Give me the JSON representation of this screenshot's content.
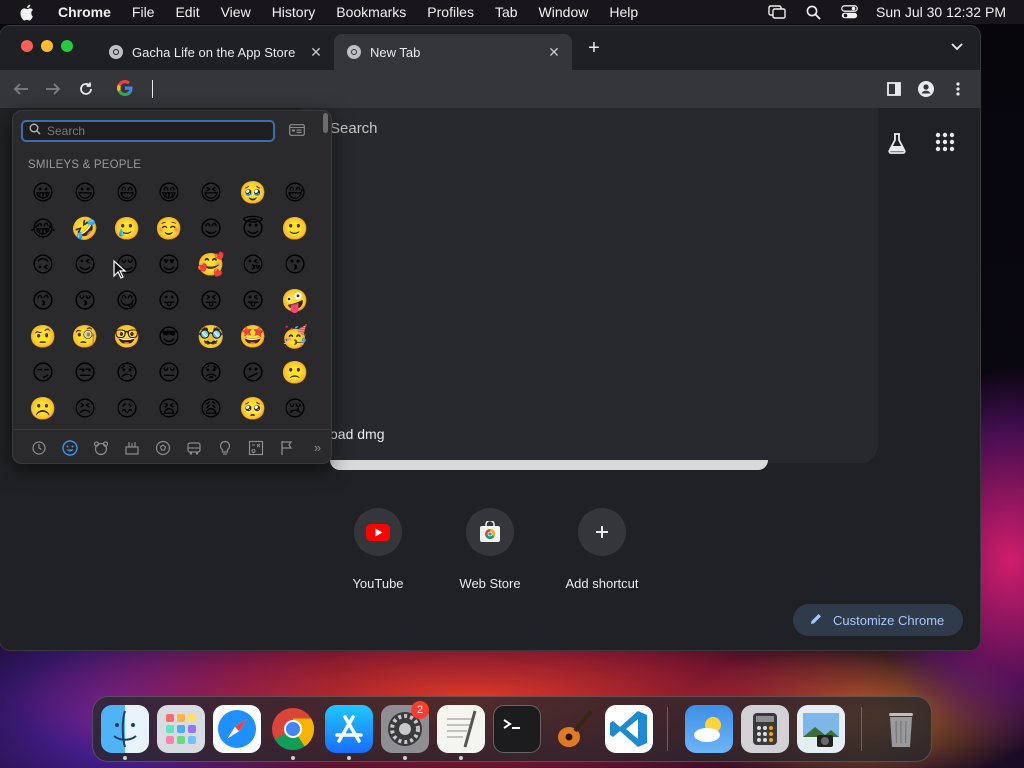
{
  "menubar": {
    "app_name": "Chrome",
    "items": [
      "File",
      "Edit",
      "View",
      "History",
      "Bookmarks",
      "Profiles",
      "Tab",
      "Window",
      "Help"
    ],
    "clock": "Sun Jul 30  12:32 PM"
  },
  "browser": {
    "tabs": [
      {
        "title": "Gacha Life on the App Store",
        "active": false
      },
      {
        "title": "New Tab",
        "active": true
      }
    ],
    "omnibox_value": ""
  },
  "newtab": {
    "search_hint": "Search",
    "suggestion": "oad dmg",
    "shortcuts": [
      {
        "label": "YouTube",
        "icon": "youtube-icon"
      },
      {
        "label": "Web Store",
        "icon": "web-store-icon"
      },
      {
        "label": "Add shortcut",
        "icon": "plus-icon"
      }
    ],
    "customize_label": "Customize Chrome"
  },
  "emoji_picker": {
    "search_placeholder": "Search",
    "section_title": "SMILEYS & PEOPLE",
    "emojis": [
      "😀",
      "😃",
      "😄",
      "😁",
      "😆",
      "🥹",
      "😅",
      "😂",
      "🤣",
      "🥲",
      "☺️",
      "😊",
      "😇",
      "🙂",
      "🙃",
      "😉",
      "😌",
      "😍",
      "🥰",
      "😘",
      "😗",
      "😙",
      "😚",
      "😋",
      "😛",
      "😝",
      "😜",
      "🤪",
      "🤨",
      "🧐",
      "🤓",
      "😎",
      "🥸",
      "🤩",
      "🥳",
      "😏",
      "😒",
      "😞",
      "😔",
      "😟",
      "😕",
      "🙁",
      "☹️",
      "😣",
      "😖",
      "😫",
      "😩",
      "🥺",
      "😢"
    ],
    "categories": [
      "recent-icon",
      "smileys-icon",
      "animals-icon",
      "food-icon",
      "activity-icon",
      "travel-icon",
      "objects-icon",
      "symbols-icon",
      "flags-icon",
      "more-icon"
    ]
  },
  "dock": {
    "apps": [
      "Finder",
      "Launchpad",
      "Safari",
      "Google Chrome",
      "App Store",
      "System Settings",
      "TextEdit",
      "Terminal",
      "GarageBand",
      "Visual Studio Code",
      "Weather",
      "Calculator",
      "Preview",
      "Trash"
    ],
    "settings_badge": "2"
  },
  "colors": {
    "window_bg": "#202124",
    "toolbar_bg": "#35363a",
    "accent_blue": "#a8c7fa",
    "badge_red": "#ff3b30"
  }
}
